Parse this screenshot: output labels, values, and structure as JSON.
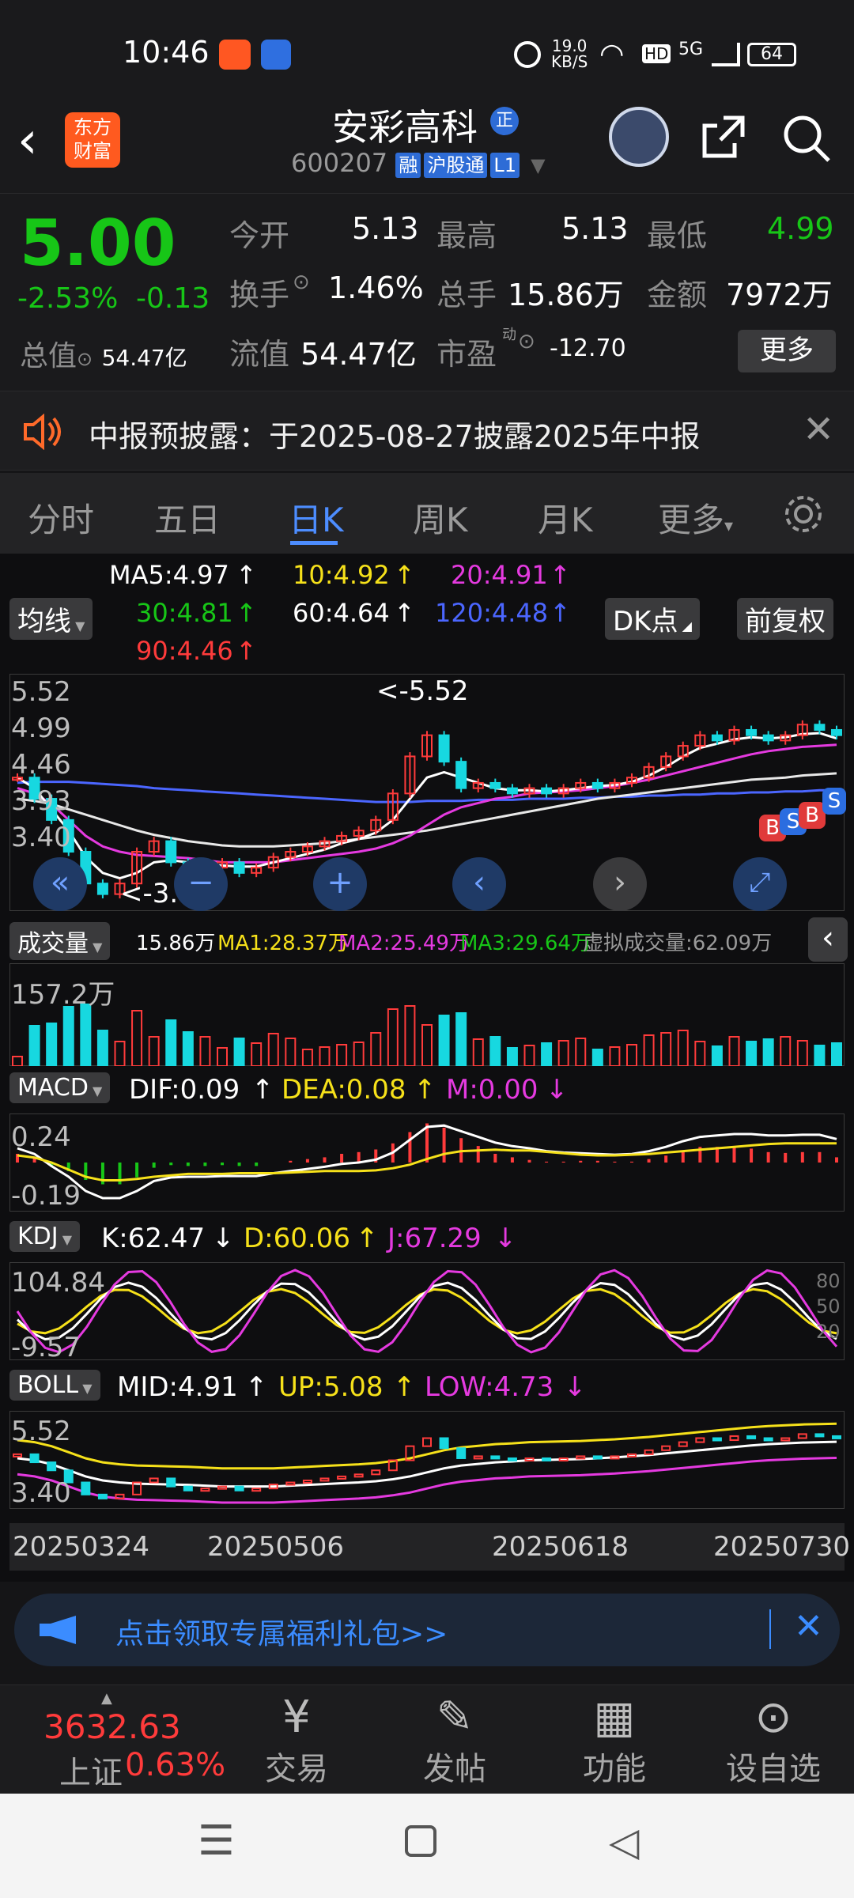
{
  "status": {
    "time": "10:46",
    "speed": "19.0",
    "speed_unit": "KB/S",
    "net": "5G",
    "battery": "64"
  },
  "header": {
    "logo_line1": "东方",
    "logo_line2": "财富",
    "stock_name": "安彩高科",
    "badge": "正",
    "code": "600207",
    "tags": [
      "融",
      "沪股通",
      "L1"
    ]
  },
  "quote": {
    "price": "5.00",
    "change_pct": "-2.53%",
    "change": "-0.13",
    "open_label": "今开",
    "open": "5.13",
    "high_label": "最高",
    "high": "5.13",
    "low_label": "最低",
    "low": "4.99",
    "turnover_label": "换手",
    "turnover": "1.46%",
    "volume_label": "总手",
    "volume": "15.86万",
    "amount_label": "金额",
    "amount": "7972万",
    "mktcap_label": "总值",
    "mktcap": "54.47亿",
    "float_label": "流值",
    "float_cap": "54.47亿",
    "pe_label": "市盈",
    "pe_sup": "动",
    "pe": "-12.70",
    "more": "更多"
  },
  "notice": {
    "text": "中报预披露：于2025-08-27披露2025年中报"
  },
  "tabs": [
    "分时",
    "五日",
    "日K",
    "周K",
    "月K",
    "更多"
  ],
  "chart": {
    "ma_button": "均线",
    "ma5": "MA5:4.97",
    "ma10": "10:4.92",
    "ma20": "20:4.91",
    "ma30": "30:4.81",
    "ma60": "60:4.64",
    "ma120": "120:4.48",
    "ma90": "90:4.46",
    "dk_button": "DK点",
    "adjust_button": "前复权",
    "price_ticks": [
      "5.52",
      "4.99",
      "4.46",
      "3.93",
      "3.40"
    ],
    "high_marker": "<-5.52",
    "low_marker": "<-3.40",
    "vol_button": "成交量",
    "vol_now": "15.86万",
    "vol_ma1": "MA1:28.37万",
    "vol_ma2": "MA2:25.49万",
    "vol_ma3": "MA3:29.64万",
    "vol_virtual": "虚拟成交量:62.09万",
    "vol_max": "157.2万",
    "macd_button": "MACD",
    "dif": "DIF:0.09",
    "dea": "DEA:0.08",
    "m": "M:0.00",
    "macd_ticks": [
      "0.24",
      "-0.19"
    ],
    "kdj_button": "KDJ",
    "k": "K:62.47",
    "d": "D:60.06",
    "j": "J:67.29",
    "kdj_ticks": [
      "104.84",
      "-9.57"
    ],
    "kdj_levels": [
      "80",
      "50",
      "20"
    ],
    "boll_button": "BOLL",
    "mid": "MID:4.91",
    "up": "UP:5.08",
    "low": "LOW:4.73",
    "boll_ticks": [
      "5.52",
      "3.40"
    ],
    "dates": [
      "20250324",
      "20250506",
      "20250618",
      "20250730"
    ],
    "signals": [
      "B",
      "S",
      "B",
      "S"
    ]
  },
  "banner": {
    "text": "点击领取专属福利礼包>>"
  },
  "bottom_nav": {
    "index_value": "3632.63",
    "index_name": "上证",
    "index_change": "0.63%",
    "items": [
      "交易",
      "发帖",
      "功能",
      "设自选"
    ]
  },
  "chart_data": {
    "type": "candlestick",
    "x_ticks": [
      "20250324",
      "20250506",
      "20250618",
      "20250730"
    ],
    "ylim": [
      3.4,
      5.52
    ],
    "price_high": 5.52,
    "price_low": 3.4,
    "volume_max": "157.2万",
    "close_path": [
      4.6,
      4.4,
      4.2,
      3.9,
      3.6,
      3.5,
      3.6,
      3.9,
      4.0,
      3.8,
      3.7,
      3.75,
      3.8,
      3.7,
      3.75,
      3.85,
      3.9,
      3.95,
      4.0,
      4.05,
      4.1,
      4.2,
      4.45,
      4.8,
      5.0,
      4.75,
      4.5,
      4.55,
      4.5,
      4.45,
      4.5,
      4.45,
      4.5,
      4.55,
      4.5,
      4.55,
      4.6,
      4.7,
      4.8,
      4.9,
      5.0,
      4.95,
      5.05,
      5.0,
      4.95,
      5.0,
      5.1,
      5.05,
      5.0
    ],
    "ma5_path": [
      4.6,
      4.5,
      4.3,
      4.1,
      3.85,
      3.7,
      3.65,
      3.7,
      3.8,
      3.82,
      3.8,
      3.78,
      3.77,
      3.76,
      3.76,
      3.8,
      3.84,
      3.88,
      3.92,
      3.98,
      4.02,
      4.08,
      4.2,
      4.4,
      4.6,
      4.65,
      4.6,
      4.55,
      4.5,
      4.48,
      4.48,
      4.47,
      4.48,
      4.5,
      4.52,
      4.53,
      4.56,
      4.62,
      4.7,
      4.8,
      4.88,
      4.92,
      4.96,
      4.98,
      4.97,
      4.98,
      5.01,
      5.02,
      4.97
    ],
    "ma20_path": [
      4.5,
      4.45,
      4.35,
      4.2,
      4.05,
      3.95,
      3.9,
      3.87,
      3.86,
      3.85,
      3.84,
      3.82,
      3.8,
      3.8,
      3.8,
      3.8,
      3.82,
      3.84,
      3.86,
      3.88,
      3.9,
      3.93,
      3.98,
      4.05,
      4.15,
      4.25,
      4.32,
      4.36,
      4.4,
      4.42,
      4.45,
      4.46,
      4.47,
      4.48,
      4.5,
      4.52,
      4.55,
      4.58,
      4.62,
      4.66,
      4.7,
      4.74,
      4.78,
      4.82,
      4.85,
      4.87,
      4.89,
      4.9,
      4.91
    ],
    "ma60_path": [
      4.4,
      4.38,
      4.35,
      4.3,
      4.25,
      4.2,
      4.15,
      4.1,
      4.06,
      4.03,
      4.0,
      3.98,
      3.96,
      3.95,
      3.95,
      3.95,
      3.96,
      3.97,
      3.98,
      4.0,
      4.02,
      4.04,
      4.06,
      4.08,
      4.1,
      4.13,
      4.16,
      4.19,
      4.22,
      4.25,
      4.28,
      4.31,
      4.34,
      4.37,
      4.4,
      4.42,
      4.44,
      4.46,
      4.48,
      4.5,
      4.52,
      4.54,
      4.56,
      4.58,
      4.59,
      4.6,
      4.62,
      4.63,
      4.64
    ],
    "ma120_path": [
      4.55,
      4.56,
      4.56,
      4.56,
      4.55,
      4.54,
      4.53,
      4.52,
      4.5,
      4.49,
      4.48,
      4.47,
      4.46,
      4.45,
      4.44,
      4.43,
      4.42,
      4.41,
      4.4,
      4.39,
      4.38,
      4.37,
      4.37,
      4.37,
      4.38,
      4.38,
      4.38,
      4.39,
      4.39,
      4.39,
      4.4,
      4.4,
      4.4,
      4.41,
      4.41,
      4.42,
      4.42,
      4.43,
      4.43,
      4.44,
      4.44,
      4.45,
      4.45,
      4.46,
      4.46,
      4.47,
      4.47,
      4.48,
      4.48
    ]
  }
}
